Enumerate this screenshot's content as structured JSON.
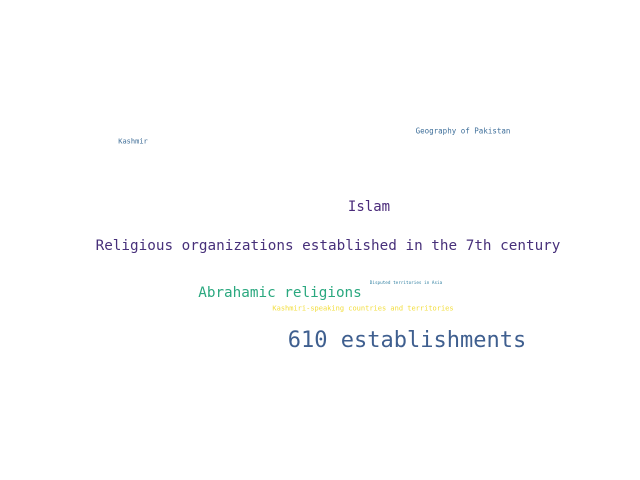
{
  "words": [
    {
      "text": "610 establishments",
      "color": "#3f5f8f"
    },
    {
      "text": "Religious organizations established in the 7th century",
      "color": "#47307a"
    },
    {
      "text": "Abrahamic religions",
      "color": "#2aa87f"
    },
    {
      "text": "Islam",
      "color": "#4a2a7a"
    },
    {
      "text": "Geography of Pakistan",
      "color": "#3f6f9a"
    },
    {
      "text": "Kashmir",
      "color": "#3a6a95"
    },
    {
      "text": "Kashmiri-speaking countries and territories",
      "color": "#f2dd3a"
    },
    {
      "text": "Disputed territories in Asia",
      "color": "#2f7fa0"
    }
  ]
}
